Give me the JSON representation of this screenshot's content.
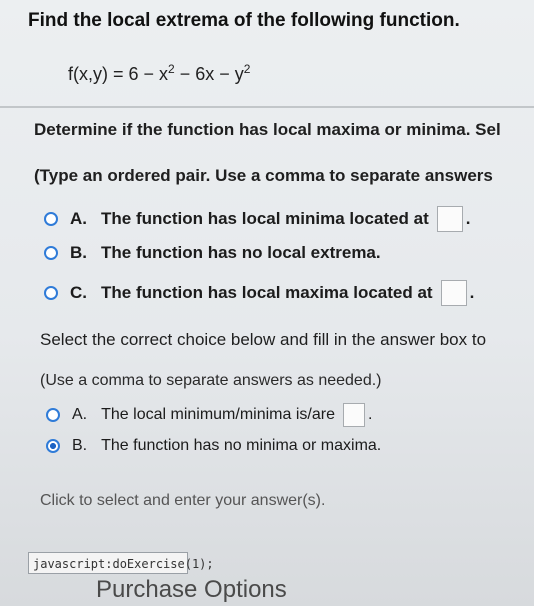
{
  "title": "Find the local extrema of the following function.",
  "function": {
    "lhs": "f(x,y) = 6 − x",
    "exp1": "2",
    "mid": " − 6x − y",
    "exp2": "2"
  },
  "part1": {
    "prompt": "Determine if the function has local maxima or minima. Sel",
    "hint": "(Type an ordered pair. Use a comma to separate answers",
    "options": [
      {
        "letter": "A.",
        "text": "The function has local minima located at",
        "has_box": true,
        "selected": false
      },
      {
        "letter": "B.",
        "text": "The function has no local extrema.",
        "has_box": false,
        "selected": false
      },
      {
        "letter": "C.",
        "text": "The function has local maxima located at",
        "has_box": true,
        "selected": false
      }
    ]
  },
  "part2": {
    "prompt": "Select the correct choice below and fill in the answer box to",
    "hint": "(Use a comma to separate answers as needed.)",
    "options": [
      {
        "letter": "A.",
        "text": "The local minimum/minima is/are",
        "has_box": true,
        "selected": false
      },
      {
        "letter": "B.",
        "text": "The function has no minima or maxima.",
        "has_box": false,
        "selected": true
      }
    ]
  },
  "footer": {
    "click_note": "Click to select and enter your answer(s).",
    "status_text": "javascript:doExercise(1);",
    "purchase": "Purchase Options"
  },
  "colors": {
    "radio_border": "#2f7bd8",
    "radio_selected": "#1c63c4"
  }
}
